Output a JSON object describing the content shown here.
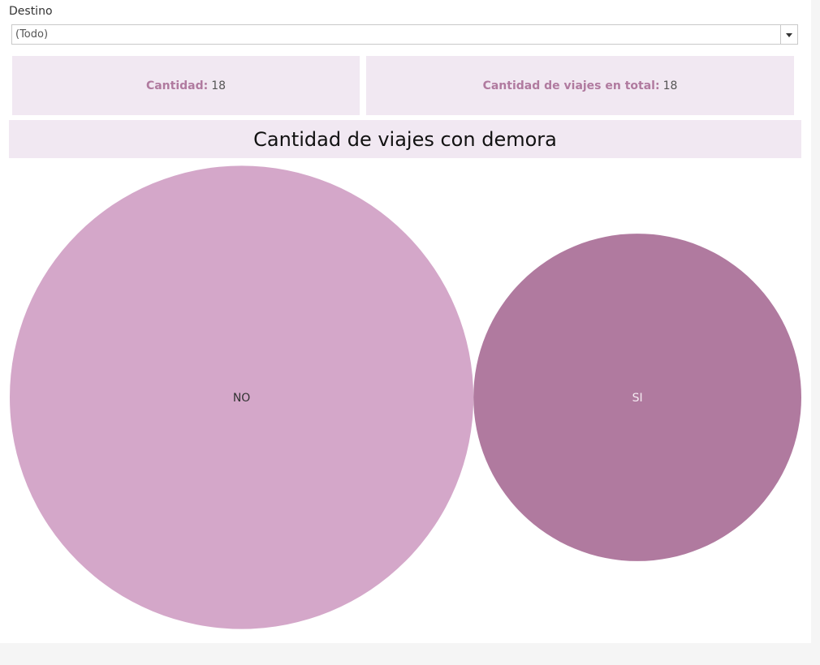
{
  "filter": {
    "label": "Destino",
    "value": "(Todo)"
  },
  "kpis": [
    {
      "label": "Cantidad:",
      "value": "18"
    },
    {
      "label": "Cantidad de viajes en total:",
      "value": "18"
    }
  ],
  "chart_data": {
    "type": "packed-bubble",
    "title": "Cantidad de viajes con demora",
    "categories": [
      "NO",
      "SI"
    ],
    "values": [
      12,
      6
    ],
    "colors": [
      "#d4a7c9",
      "#b07a9f"
    ],
    "label_colors": [
      "#333333",
      "#f5eaf2"
    ]
  },
  "colors": {
    "accent": "#b07a9f",
    "panel_bg": "#f1e8f2"
  }
}
